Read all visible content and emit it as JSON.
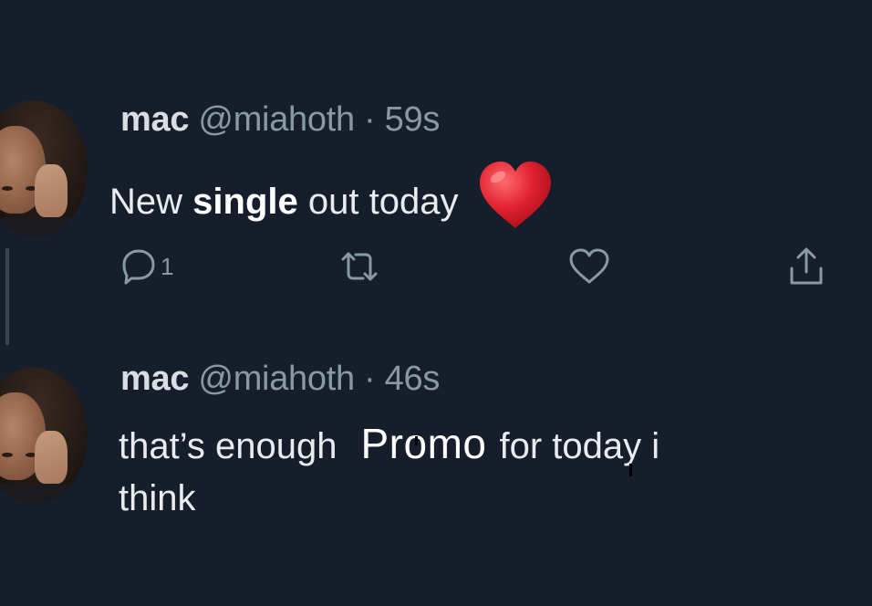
{
  "tweets": [
    {
      "display_name": "mac",
      "handle": "@miahoth",
      "time": "59s",
      "text_before": "New",
      "text_bold": "single",
      "text_after": "out today",
      "emoji": "red-heart",
      "reply_count": "1"
    },
    {
      "display_name": "mac",
      "handle": "@miahoth",
      "time": "46s",
      "text_before": "that’s enough",
      "text_insert": "Promo",
      "text_after": "for today i",
      "text_line2": "think"
    }
  ],
  "separator": " · ",
  "colors": {
    "background": "#151e2a",
    "primary_text": "#e8ecef",
    "secondary_text": "#8899a6",
    "heart_emoji": "#e0202e"
  },
  "icons": {
    "reply": "reply-icon",
    "retweet": "retweet-icon",
    "like": "heart-outline-icon",
    "share": "share-icon"
  }
}
